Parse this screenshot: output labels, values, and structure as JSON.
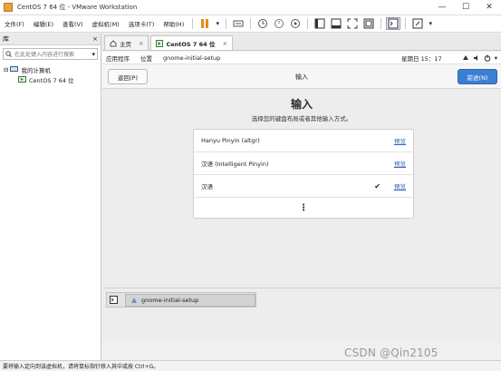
{
  "window": {
    "title": "CentOS 7 64 位 - VMware Workstation"
  },
  "menu": {
    "items": [
      "文件(F)",
      "编辑(E)",
      "查看(V)",
      "虚拟机(M)",
      "选项卡(T)",
      "帮助(H)"
    ]
  },
  "library": {
    "title": "库",
    "close_glyph": "×",
    "search_placeholder": "在此处键入内容进行搜索",
    "root": "我的计算机",
    "vm": "CentOS 7 64 位"
  },
  "tabs": [
    {
      "label": "主页",
      "close": "×"
    },
    {
      "label": "CentOS 7 64 位",
      "close": "×"
    }
  ],
  "guest": {
    "topbar": {
      "apps": "应用程序",
      "places": "位置",
      "active_app": "gnome-initial-setup",
      "clock": "星期日 15：17"
    },
    "header": {
      "back": "返回(P)",
      "title": "输入",
      "next": "前进(N)"
    },
    "heading": "输入",
    "subtitle": "选择您的键盘布局或者其他输入方式。",
    "options": [
      {
        "label": "Hanyu Pinyin (altgr)",
        "preview": "预览",
        "selected": false
      },
      {
        "label": "汉语 (Intelligent Pinyin)",
        "preview": "预览",
        "selected": false
      },
      {
        "label": "汉语",
        "preview": "预览",
        "selected": true
      }
    ],
    "more_glyph": "⋮",
    "check_glyph": "✔",
    "taskbar": {
      "item": "gnome-initial-setup"
    }
  },
  "status": {
    "text": "要将输入定向到该虚拟机，请将鼠标指针移入其中或按 Ctrl+G。"
  },
  "watermark": "CSDN @Qin2105"
}
